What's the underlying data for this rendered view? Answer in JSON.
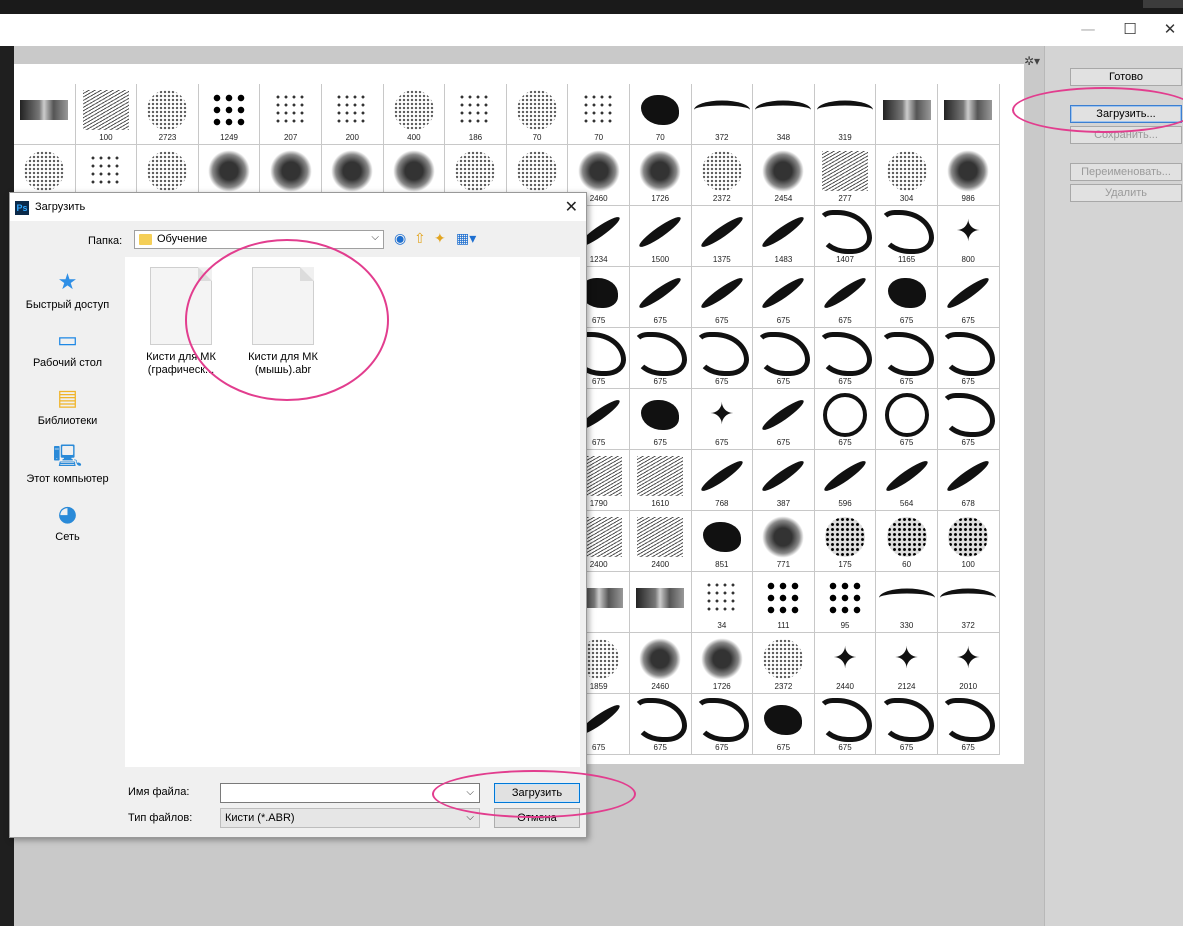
{
  "window": {
    "min_glyph": "—",
    "max_glyph": "☐",
    "close_glyph": "✕"
  },
  "right_panel": {
    "done_label": "Готово",
    "load_label": "Загрузить...",
    "save_label": "Сохранить...",
    "rename_label": "Переименовать...",
    "delete_label": "Удалить"
  },
  "brush_sizes": [
    "",
    "100",
    "2723",
    "1249",
    "207",
    "200",
    "400",
    "186",
    "70",
    "70",
    "70",
    "372",
    "348",
    "319",
    "",
    "",
    "",
    "",
    "",
    "",
    "",
    "",
    "",
    "",
    "",
    "2460",
    "1726",
    "2372",
    "2454",
    "277",
    "304",
    "986",
    "",
    "",
    "",
    "",
    "",
    "",
    "",
    "",
    "",
    "1234",
    "1500",
    "1375",
    "1483",
    "1407",
    "1165",
    "800",
    "",
    "",
    "",
    "",
    "",
    "",
    "",
    "",
    "",
    "675",
    "675",
    "675",
    "675",
    "675",
    "675",
    "675",
    "",
    "",
    "",
    "",
    "",
    "",
    "",
    "",
    "",
    "675",
    "675",
    "675",
    "675",
    "675",
    "675",
    "675",
    "",
    "",
    "",
    "",
    "",
    "",
    "",
    "",
    "",
    "675",
    "675",
    "675",
    "675",
    "675",
    "675",
    "675",
    "",
    "",
    "",
    "",
    "",
    "",
    "",
    "",
    "",
    "1790",
    "1610",
    "768",
    "387",
    "596",
    "564",
    "678",
    "",
    "",
    "",
    "",
    "",
    "",
    "",
    "",
    "",
    "2400",
    "2400",
    "851",
    "771",
    "175",
    "60",
    "100",
    "",
    "",
    "",
    "",
    "",
    "",
    "",
    "",
    "",
    "",
    "",
    "34",
    "111",
    "95",
    "330",
    "372",
    "",
    "",
    "",
    "",
    "",
    "",
    "",
    "",
    "",
    "1859",
    "2460",
    "1726",
    "2372",
    "2440",
    "2124",
    "2010",
    "",
    "",
    "",
    "",
    "",
    "",
    "",
    "",
    "",
    "675",
    "675",
    "675",
    "675",
    "675",
    "675",
    "675"
  ],
  "dialog": {
    "title": "Загрузить",
    "close_glyph": "✕",
    "folder_label": "Папка:",
    "folder_value": "Обучение",
    "places": [
      {
        "label": "Быстрый доступ",
        "glyph": "★"
      },
      {
        "label": "Рабочий стол",
        "glyph": "▭"
      },
      {
        "label": "Библиотеки",
        "glyph": "▤"
      },
      {
        "label": "Этот компьютер",
        "glyph": "🖳"
      },
      {
        "label": "Сеть",
        "glyph": "◕"
      }
    ],
    "files": [
      {
        "name_line1": "Кисти для МК",
        "name_line2": "(графическ..."
      },
      {
        "name_line1": "Кисти для МК",
        "name_line2": "(мышь).abr"
      }
    ],
    "filename_label": "Имя файла:",
    "filename_value": "",
    "filetype_label": "Тип файлов:",
    "filetype_value": "Кисти (*.ABR)",
    "open_label": "Загрузить",
    "cancel_label": "Отмена"
  },
  "colors": {
    "highlight": "#e23d8e",
    "accent": "#0078d7"
  }
}
